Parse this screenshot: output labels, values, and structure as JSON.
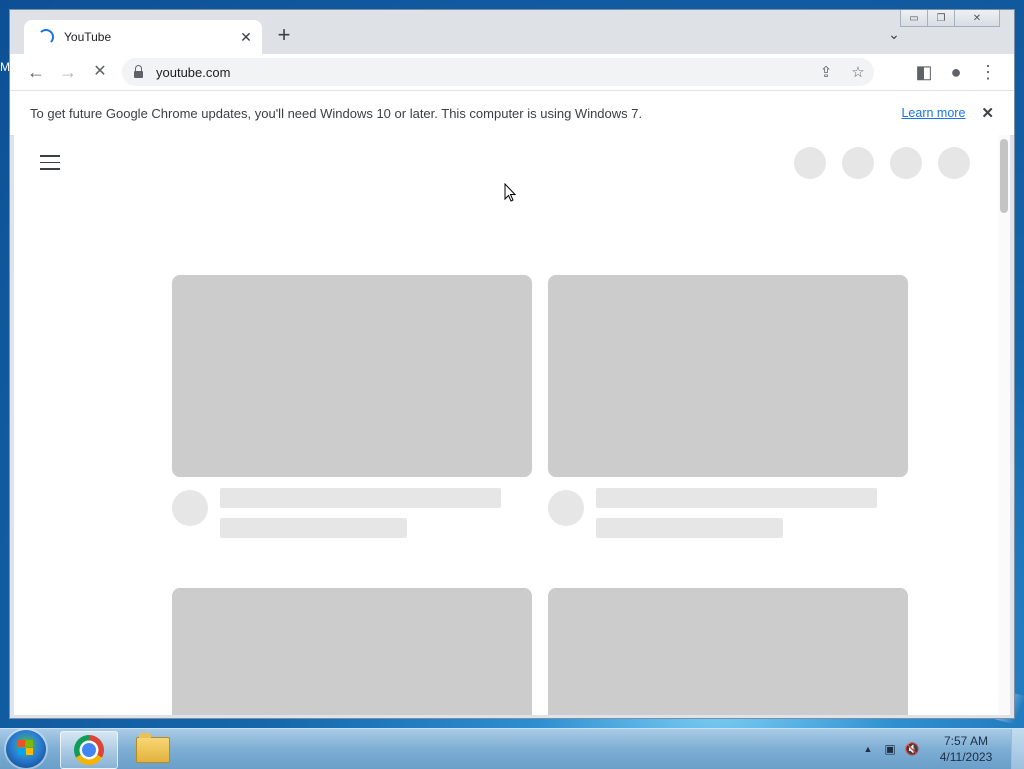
{
  "desktop": {
    "edge_text": "M"
  },
  "browser": {
    "window_controls": {
      "minimize": "▭",
      "restore": "❐",
      "close": "✕"
    },
    "tab": {
      "title": "YouTube",
      "close_label": "✕"
    },
    "new_tab_label": "+",
    "tab_search_label": "⌄",
    "toolbar": {
      "back": "←",
      "forward": "→",
      "stop": "✕",
      "url": "youtube.com"
    },
    "omnibox_icons": {
      "share": "⇪",
      "bookmark": "☆",
      "side_panel": "◧",
      "profile": "●",
      "menu": "⋮"
    },
    "infobar": {
      "message": "To get future Google Chrome updates, you'll need Windows 10 or later. This computer is using Windows 7.",
      "link": "Learn more",
      "close": "✕"
    }
  },
  "page": {
    "state": "loading-skeleton"
  },
  "taskbar": {
    "apps": [
      "chrome-icon",
      "file-explorer-icon"
    ],
    "tray": {
      "show_hidden": "▲",
      "network": "▣",
      "volume": "🔇"
    },
    "clock": {
      "time": "7:57 AM",
      "date": "4/11/2023"
    }
  }
}
